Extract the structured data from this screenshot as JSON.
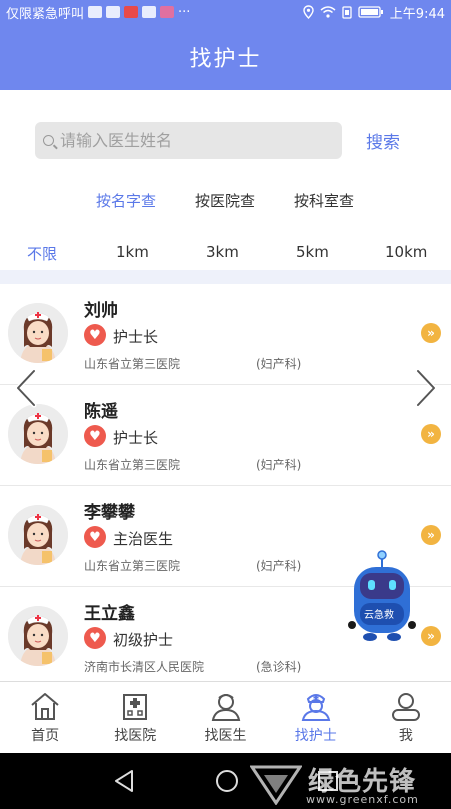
{
  "status_bar": {
    "left_text": "仅限紧急呼叫",
    "dots": "···",
    "time": "上午9:44"
  },
  "header": {
    "title": "找护士"
  },
  "search": {
    "placeholder": "请输入医生姓名",
    "button_label": "搜索"
  },
  "query_tabs": [
    {
      "label": "按名字查",
      "active": true
    },
    {
      "label": "按医院查",
      "active": false
    },
    {
      "label": "按科室查",
      "active": false
    }
  ],
  "distance_filters": [
    {
      "label": "不限",
      "active": true
    },
    {
      "label": "1km",
      "active": false
    },
    {
      "label": "3km",
      "active": false
    },
    {
      "label": "5km",
      "active": false
    },
    {
      "label": "10km",
      "active": false
    }
  ],
  "nurses": [
    {
      "name": "刘帅",
      "title": "护士长",
      "hospital": "山东省立第三医院",
      "department": "(妇产科)"
    },
    {
      "name": "陈遥",
      "title": "护士长",
      "hospital": "山东省立第三医院",
      "department": "(妇产科)"
    },
    {
      "name": "李攀攀",
      "title": "主治医生",
      "hospital": "山东省立第三医院",
      "department": "(妇产科)"
    },
    {
      "name": "王立鑫",
      "title": "初级护士",
      "hospital": "济南市长清区人民医院",
      "department": "(急诊科)"
    }
  ],
  "robot": {
    "label": "云急救"
  },
  "bottom_nav": [
    {
      "label": "首页",
      "icon": "home-icon",
      "active": false
    },
    {
      "label": "找医院",
      "icon": "hospital-icon",
      "active": false
    },
    {
      "label": "找医生",
      "icon": "doctor-icon",
      "active": false
    },
    {
      "label": "找护士",
      "icon": "nurse-icon",
      "active": true
    },
    {
      "label": "我",
      "icon": "user-icon",
      "active": false
    }
  ],
  "watermark": {
    "name": "绿色先锋",
    "url": "www.greenxf.com"
  },
  "colors": {
    "primary": "#6f87ee",
    "accent": "#5a78e8",
    "heart": "#ee5a4e",
    "go": "#f2b441"
  }
}
